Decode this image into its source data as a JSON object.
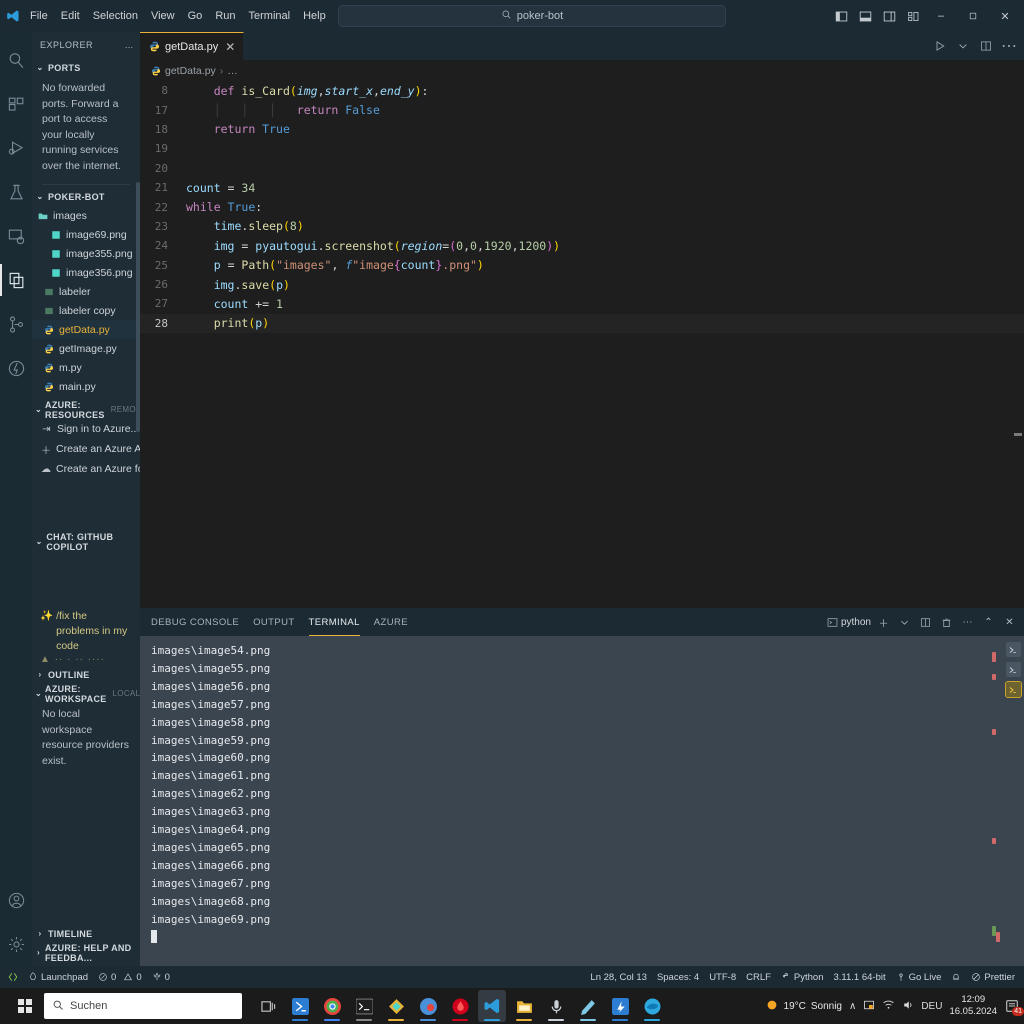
{
  "titlebar": {
    "menus": [
      "File",
      "Edit",
      "Selection",
      "View",
      "Go",
      "Run",
      "Terminal",
      "Help"
    ],
    "back_arrow": "←",
    "forward_arrow": "→",
    "search_value": "poker-bot",
    "search_icon": "search-icon",
    "window_controls": {
      "minimize": "–",
      "restore": "❐",
      "close": "✕"
    }
  },
  "activitybar": {
    "items": [
      {
        "name": "search",
        "label": "Search"
      },
      {
        "name": "extensions",
        "label": "Extensions"
      },
      {
        "name": "run-and-debug",
        "label": "Run and Debug"
      },
      {
        "name": "testing",
        "label": "Testing"
      },
      {
        "name": "remote-explorer",
        "label": "Remote Explorer"
      },
      {
        "name": "explorer",
        "label": "Explorer",
        "active": true
      },
      {
        "name": "source-control",
        "label": "Source Control"
      },
      {
        "name": "azure",
        "label": "Azure"
      }
    ],
    "bottom": [
      {
        "name": "accounts",
        "label": "Accounts"
      },
      {
        "name": "manage",
        "label": "Manage"
      }
    ]
  },
  "sidebar": {
    "title": "EXPLORER",
    "more_label": "…",
    "ports": {
      "header": "PORTS",
      "description": "No forwarded ports. Forward a port to access your locally running services over the internet."
    },
    "project": {
      "header": "POKER-BOT",
      "files": [
        {
          "label": "images",
          "type": "folder",
          "indent": 0
        },
        {
          "label": "image69.png",
          "type": "image",
          "indent": 1
        },
        {
          "label": "image355.png",
          "type": "image",
          "indent": 1
        },
        {
          "label": "image356.png",
          "type": "image",
          "indent": 1
        },
        {
          "label": "labeler",
          "type": "folder",
          "indent": 0
        },
        {
          "label": "labeler copy",
          "type": "folder",
          "indent": 0
        },
        {
          "label": "getData.py",
          "type": "python",
          "indent": 0,
          "selected": true
        },
        {
          "label": "getImage.py",
          "type": "python",
          "indent": 0
        },
        {
          "label": "m.py",
          "type": "python",
          "indent": 0
        },
        {
          "label": "main.py",
          "type": "python",
          "indent": 0
        }
      ]
    },
    "azure_resources": {
      "header": "AZURE: RESOURCES",
      "suffix": "Remo...",
      "items": [
        {
          "label": "Sign in to Azure...",
          "icon": "sign-in-icon"
        },
        {
          "label": "Create an Azure Ac...",
          "icon": "plus-icon"
        },
        {
          "label": "Create an Azure for...",
          "icon": "cloud-icon"
        }
      ]
    },
    "copilot": {
      "header": "CHAT: GITHUB COPILOT",
      "suggestion": "/fix the problems in my code",
      "suggestion_icon": "sparkle-icon",
      "more_dots": "▲ ·· · ·· ····"
    },
    "outline": {
      "header": "OUTLINE"
    },
    "azure_workspace": {
      "header": "AZURE: WORKSPACE",
      "suffix": "Local",
      "description": "No local workspace resource providers exist."
    },
    "timeline": {
      "header": "TIMELINE"
    },
    "azure_help": {
      "header": "AZURE: HELP AND FEEDBA..."
    }
  },
  "editor": {
    "tab": {
      "label": "getData.py",
      "icon": "python-icon",
      "close": "✕"
    },
    "actions": [
      "run-python-button",
      "run-chevron",
      "split-editor-button",
      "more-actions-button"
    ],
    "breadcrumb": {
      "file": "getData.py",
      "separator": "›",
      "rest": "…"
    },
    "lines": [
      {
        "no": "8",
        "segments": [
          {
            "t": "    ",
            "c": "plain"
          },
          {
            "t": "def ",
            "c": "k-kw"
          },
          {
            "t": "is_Card",
            "c": "k-fn"
          },
          {
            "t": "(",
            "c": "k-brkt1"
          },
          {
            "t": "img",
            "c": "k-par"
          },
          {
            "t": ",",
            "c": "k-punct"
          },
          {
            "t": "start_x",
            "c": "k-par"
          },
          {
            "t": ",",
            "c": "k-punct"
          },
          {
            "t": "end_y",
            "c": "k-par"
          },
          {
            "t": ")",
            "c": "k-brkt1"
          },
          {
            "t": ":",
            "c": "k-punct"
          }
        ]
      },
      {
        "no": "17",
        "segments": [
          {
            "t": "    │   │   │   ",
            "c": "guide"
          },
          {
            "t": "return ",
            "c": "k-kw"
          },
          {
            "t": "False",
            "c": "k-blue"
          }
        ]
      },
      {
        "no": "18",
        "segments": [
          {
            "t": "    ",
            "c": "plain"
          },
          {
            "t": "return ",
            "c": "k-kw"
          },
          {
            "t": "True",
            "c": "k-blue"
          }
        ]
      },
      {
        "no": "19",
        "segments": []
      },
      {
        "no": "20",
        "segments": []
      },
      {
        "no": "21",
        "segments": [
          {
            "t": "count ",
            "c": "k-var"
          },
          {
            "t": "= ",
            "c": "k-op"
          },
          {
            "t": "34",
            "c": "k-num"
          }
        ]
      },
      {
        "no": "22",
        "segments": [
          {
            "t": "while ",
            "c": "k-kw"
          },
          {
            "t": "True",
            "c": "k-blue"
          },
          {
            "t": ":",
            "c": "k-punct"
          }
        ]
      },
      {
        "no": "23",
        "segments": [
          {
            "t": "    ",
            "c": "plain"
          },
          {
            "t": "time",
            "c": "k-var"
          },
          {
            "t": ".",
            "c": "k-punct"
          },
          {
            "t": "sleep",
            "c": "k-fn"
          },
          {
            "t": "(",
            "c": "k-brkt1"
          },
          {
            "t": "8",
            "c": "k-num"
          },
          {
            "t": ")",
            "c": "k-brkt1"
          }
        ]
      },
      {
        "no": "24",
        "segments": [
          {
            "t": "    ",
            "c": "plain"
          },
          {
            "t": "img ",
            "c": "k-var"
          },
          {
            "t": "= ",
            "c": "k-op"
          },
          {
            "t": "pyautogui",
            "c": "k-var"
          },
          {
            "t": ".",
            "c": "k-punct"
          },
          {
            "t": "screenshot",
            "c": "k-fn"
          },
          {
            "t": "(",
            "c": "k-brkt1"
          },
          {
            "t": "region",
            "c": "k-par"
          },
          {
            "t": "=",
            "c": "k-op"
          },
          {
            "t": "(",
            "c": "k-brkt2"
          },
          {
            "t": "0",
            "c": "k-num"
          },
          {
            "t": ",",
            "c": "k-punct"
          },
          {
            "t": "0",
            "c": "k-num"
          },
          {
            "t": ",",
            "c": "k-punct"
          },
          {
            "t": "1920",
            "c": "k-num"
          },
          {
            "t": ",",
            "c": "k-punct"
          },
          {
            "t": "1200",
            "c": "k-num"
          },
          {
            "t": ")",
            "c": "k-brkt2"
          },
          {
            "t": ")",
            "c": "k-brkt1"
          }
        ]
      },
      {
        "no": "25",
        "segments": [
          {
            "t": "    ",
            "c": "plain"
          },
          {
            "t": "p ",
            "c": "k-var"
          },
          {
            "t": "= ",
            "c": "k-op"
          },
          {
            "t": "Path",
            "c": "k-fn"
          },
          {
            "t": "(",
            "c": "k-brkt1"
          },
          {
            "t": "\"images\"",
            "c": "k-str"
          },
          {
            "t": ", ",
            "c": "k-punct"
          },
          {
            "t": "f",
            "c": "k-fstr"
          },
          {
            "t": "\"image",
            "c": "k-str"
          },
          {
            "t": "{",
            "c": "k-brkt2"
          },
          {
            "t": "count",
            "c": "k-var"
          },
          {
            "t": "}",
            "c": "k-brkt2"
          },
          {
            "t": ".png\"",
            "c": "k-str"
          },
          {
            "t": ")",
            "c": "k-brkt1"
          }
        ]
      },
      {
        "no": "26",
        "segments": [
          {
            "t": "    ",
            "c": "plain"
          },
          {
            "t": "img",
            "c": "k-var"
          },
          {
            "t": ".",
            "c": "k-punct"
          },
          {
            "t": "save",
            "c": "k-fn"
          },
          {
            "t": "(",
            "c": "k-brkt1"
          },
          {
            "t": "p",
            "c": "k-var"
          },
          {
            "t": ")",
            "c": "k-brkt1"
          }
        ]
      },
      {
        "no": "27",
        "segments": [
          {
            "t": "    ",
            "c": "plain"
          },
          {
            "t": "count ",
            "c": "k-var"
          },
          {
            "t": "+= ",
            "c": "k-op"
          },
          {
            "t": "1",
            "c": "k-num"
          }
        ]
      },
      {
        "no": "28",
        "segments": [
          {
            "t": "    ",
            "c": "plain"
          },
          {
            "t": "print",
            "c": "k-fn"
          },
          {
            "t": "(",
            "c": "k-brkt1"
          },
          {
            "t": "p",
            "c": "k-var"
          },
          {
            "t": ")",
            "c": "k-brkt1"
          }
        ],
        "current": true
      }
    ]
  },
  "panel": {
    "tabs": [
      {
        "label": "DEBUG CONSOLE",
        "active": false
      },
      {
        "label": "OUTPUT",
        "active": false
      },
      {
        "label": "TERMINAL",
        "active": true
      },
      {
        "label": "AZURE",
        "active": false
      }
    ],
    "shell_label": "python",
    "actions": [
      "new-terminal-button",
      "split-terminal-button",
      "kill-terminal-button",
      "more-actions-button",
      "maximize-panel-button",
      "close-panel-button"
    ],
    "terminal_lines": [
      "images\\image54.png",
      "images\\image55.png",
      "images\\image56.png",
      "images\\image57.png",
      "images\\image58.png",
      "images\\image59.png",
      "images\\image60.png",
      "images\\image61.png",
      "images\\image62.png",
      "images\\image63.png",
      "images\\image64.png",
      "images\\image65.png",
      "images\\image66.png",
      "images\\image67.png",
      "images\\image68.png",
      "images\\image69.png"
    ],
    "terminal_tabs": [
      {
        "name": "powershell-1",
        "active": false
      },
      {
        "name": "powershell-2",
        "active": false
      },
      {
        "name": "python-terminal",
        "active": true
      }
    ]
  },
  "statusbar": {
    "remote_icon": "remote-indicator",
    "left": [
      {
        "label": "Launchpad",
        "icon": "rocket-icon"
      },
      {
        "label": "0",
        "icon": "error-icon"
      },
      {
        "label": "0",
        "icon": "warning-icon"
      },
      {
        "label": "0",
        "icon": "ports-icon"
      }
    ],
    "right": [
      {
        "label": "Ln 28, Col 13",
        "name": "cursor-position"
      },
      {
        "label": "Spaces: 4",
        "name": "indentation"
      },
      {
        "label": "UTF-8",
        "name": "encoding"
      },
      {
        "label": "CRLF",
        "name": "eol"
      },
      {
        "label": "Python",
        "name": "language-mode"
      },
      {
        "label": "3.11.1 64-bit",
        "name": "python-interpreter"
      },
      {
        "label": "Go Live",
        "name": "go-live"
      },
      {
        "label": "",
        "name": "bell"
      },
      {
        "label": "Prettier",
        "name": "prettier"
      }
    ]
  },
  "taskbar": {
    "start_label": "start-button",
    "search_placeholder": "Suchen",
    "apps": [
      {
        "name": "task-view",
        "color": "#c8c8c8"
      },
      {
        "name": "terminal-powershell",
        "color": "#2d7dd2"
      },
      {
        "name": "google-chrome",
        "color": "#e8453c"
      },
      {
        "name": "command-prompt",
        "color": "#2b2b2b"
      },
      {
        "name": "file-manager",
        "color": "#e8b339"
      },
      {
        "name": "chrome-profile",
        "color": "#4a90d9"
      },
      {
        "name": "video-app",
        "color": "#d0021b"
      },
      {
        "name": "vs-code",
        "color": "#2d7dd2",
        "active": true
      },
      {
        "name": "file-explorer",
        "color": "#e8b339"
      },
      {
        "name": "microphone-app",
        "color": "#b8c2cc"
      },
      {
        "name": "notes-app",
        "color": "#7ec8e3"
      },
      {
        "name": "azure-app",
        "color": "#2d7dd2"
      },
      {
        "name": "microsoft-edge",
        "color": "#2ea9e0"
      }
    ],
    "tray": {
      "weather_temp": "19°C",
      "weather_desc": "Sonnig",
      "chevron": "∧",
      "language": "DEU",
      "time": "12:09",
      "date": "16.05.2024",
      "notification_count": "41"
    }
  }
}
